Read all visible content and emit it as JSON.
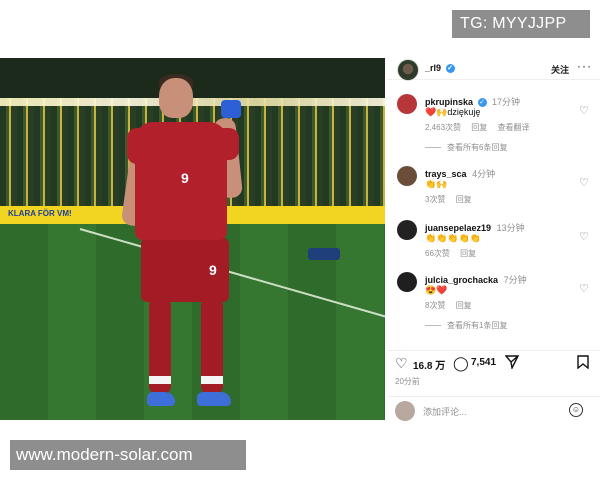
{
  "watermarks": {
    "top": "TG: MYYJJPP",
    "bottom": "www.modern-solar.com"
  },
  "photo": {
    "adboard_text": "KLARA FÖR VM!",
    "shirt_number": "9",
    "shorts_number": "9"
  },
  "post_header": {
    "username": "_rl9",
    "verified_icon": "verified-badge-icon",
    "follow_label": "关注",
    "more_label": "···"
  },
  "comments": [
    {
      "username": "pkrupinska",
      "verified": true,
      "time": "17分钟",
      "text": "❤️🙌dziękuję",
      "meta": [
        "2,463次赞",
        "回复",
        "查看翻译"
      ],
      "view_replies": "查看所有6条回复",
      "avatar_color": "#b7363a"
    },
    {
      "username": "trays_sca",
      "verified": false,
      "time": "4分钟",
      "text": "👏🙌",
      "meta": [
        "3次赞",
        "回复"
      ],
      "view_replies": "",
      "avatar_color": "#6a4e3a"
    },
    {
      "username": "juansepelaez19",
      "verified": false,
      "time": "13分钟",
      "text": "👏👏👏👏👏",
      "meta": [
        "66次赞",
        "回复"
      ],
      "view_replies": "",
      "avatar_color": "#222222"
    },
    {
      "username": "julcia_grochacka",
      "verified": false,
      "time": "7分钟",
      "text": "😍❤️",
      "meta": [
        "8次赞",
        "回复"
      ],
      "view_replies": "查看所有1条回复",
      "avatar_color": "#1f1f1f"
    }
  ],
  "actions": {
    "likes": "16.8 万",
    "comments": "7,541",
    "time_ago": "20分前"
  },
  "composer": {
    "placeholder": "添加评论..."
  }
}
